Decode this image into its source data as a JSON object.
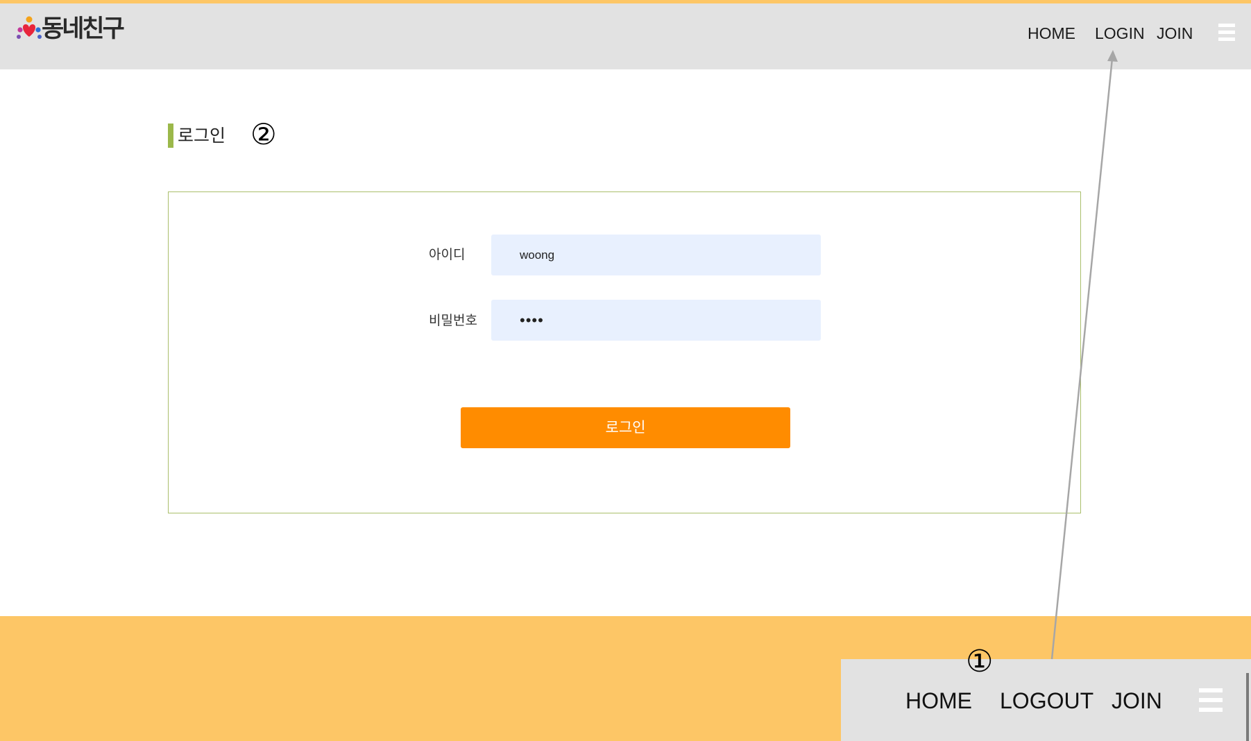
{
  "header": {
    "logo_text": "동네친구",
    "nav": {
      "home": "HOME",
      "login": "LOGIN",
      "join": "JOIN"
    }
  },
  "page": {
    "title": "로그인"
  },
  "form": {
    "id_label": "아이디",
    "id_value": "woong",
    "password_label": "비밀번호",
    "password_value": "••••",
    "submit_label": "로그인"
  },
  "annotations": {
    "marker_1": "①",
    "marker_2": "②"
  },
  "inset_header": {
    "home": "HOME",
    "logout": "LOGOUT",
    "join": "JOIN"
  },
  "colors": {
    "accent_orange": "#FF8C00",
    "footer_band": "#FDC666",
    "title_bar_green": "#9BB84A",
    "header_bg": "#E2E2E2",
    "input_bg": "#E8F0FE"
  },
  "icons": {
    "logo": "people-heart-logo-icon",
    "menu": "hamburger-menu-icon"
  }
}
